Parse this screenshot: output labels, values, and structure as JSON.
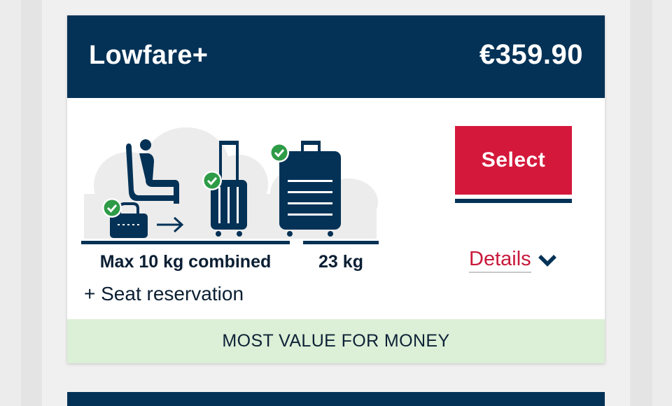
{
  "fare": {
    "name": "Lowfare+",
    "price": "€359.90"
  },
  "baggage": {
    "cabin_caption": "Max 10 kg combined",
    "checked_caption": "23 kg",
    "extra": "+ Seat reservation"
  },
  "actions": {
    "select_label": "Select",
    "details_label": "Details"
  },
  "banner": {
    "text": "MOST VALUE FOR MONEY"
  },
  "icons": [
    "seat-icon",
    "handbag-icon",
    "arrow-right-icon",
    "trolley-icon",
    "suitcase-icon",
    "check-icon",
    "chevron-down-icon"
  ],
  "colors": {
    "header": "#043256",
    "accent": "#d4183b",
    "banner": "#dcefd7",
    "check": "#2e9b47"
  }
}
